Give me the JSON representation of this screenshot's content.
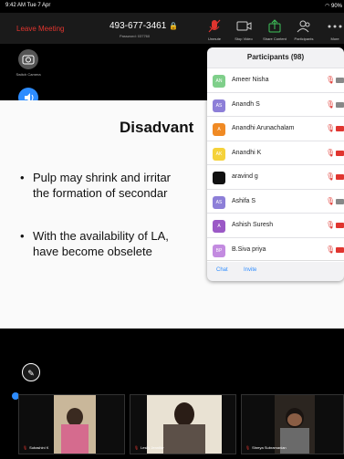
{
  "status_bar": {
    "time_date": "9:42 AM  Tue 7 Apr",
    "battery": "90%"
  },
  "toolbar": {
    "leave_label": "Leave Meeting",
    "meeting_id": "493-677-3461",
    "passcode": "Password: 037760",
    "buttons": [
      {
        "label": "Unmute",
        "icon": "mic-muted-icon"
      },
      {
        "label": "Stop Video",
        "icon": "video-icon"
      },
      {
        "label": "Share Content",
        "icon": "share-icon"
      },
      {
        "label": "Participants",
        "icon": "participants-icon"
      },
      {
        "label": "More",
        "icon": "more-icon"
      }
    ]
  },
  "side": {
    "switch_camera": "Switch Camera",
    "bluetooth": "Bluetooth"
  },
  "slide": {
    "title": "Disadvant",
    "bullet1_line1": "Pulp may shrink and irritar",
    "bullet1_line2": "the formation of secondar",
    "bullet2_line1": "With the availability of LA,",
    "bullet2_line2": "have become obselete"
  },
  "participants": {
    "title": "Participants (98)",
    "list": [
      {
        "initials": "AN",
        "name": "Ameer Nisha",
        "color": "#7fcf8a",
        "video": "gray"
      },
      {
        "initials": "AS",
        "name": "Anandh S",
        "color": "#8d7fd8",
        "video": "gray"
      },
      {
        "initials": "A",
        "name": "Anandhi Arunachalam",
        "color": "#f08a24",
        "video": "red"
      },
      {
        "initials": "AK",
        "name": "Anandhi K",
        "color": "#f5d23a",
        "video": "red"
      },
      {
        "initials": "",
        "name": "aravind g",
        "color": "#111111",
        "video": "red"
      },
      {
        "initials": "AS",
        "name": "Ashifa S",
        "color": "#8d7fd8",
        "video": "gray"
      },
      {
        "initials": "A",
        "name": "Ashish Suresh",
        "color": "#9b59c6",
        "video": "red"
      },
      {
        "initials": "BP",
        "name": "B.Siva priya",
        "color": "#c38be0",
        "video": "red"
      }
    ],
    "chat_label": "Chat",
    "invite_label": "Invite"
  },
  "gallery": [
    {
      "name": "Subashini K"
    },
    {
      "name": "Leslly Jennifar"
    },
    {
      "name": "Shreya Subramanian"
    }
  ]
}
